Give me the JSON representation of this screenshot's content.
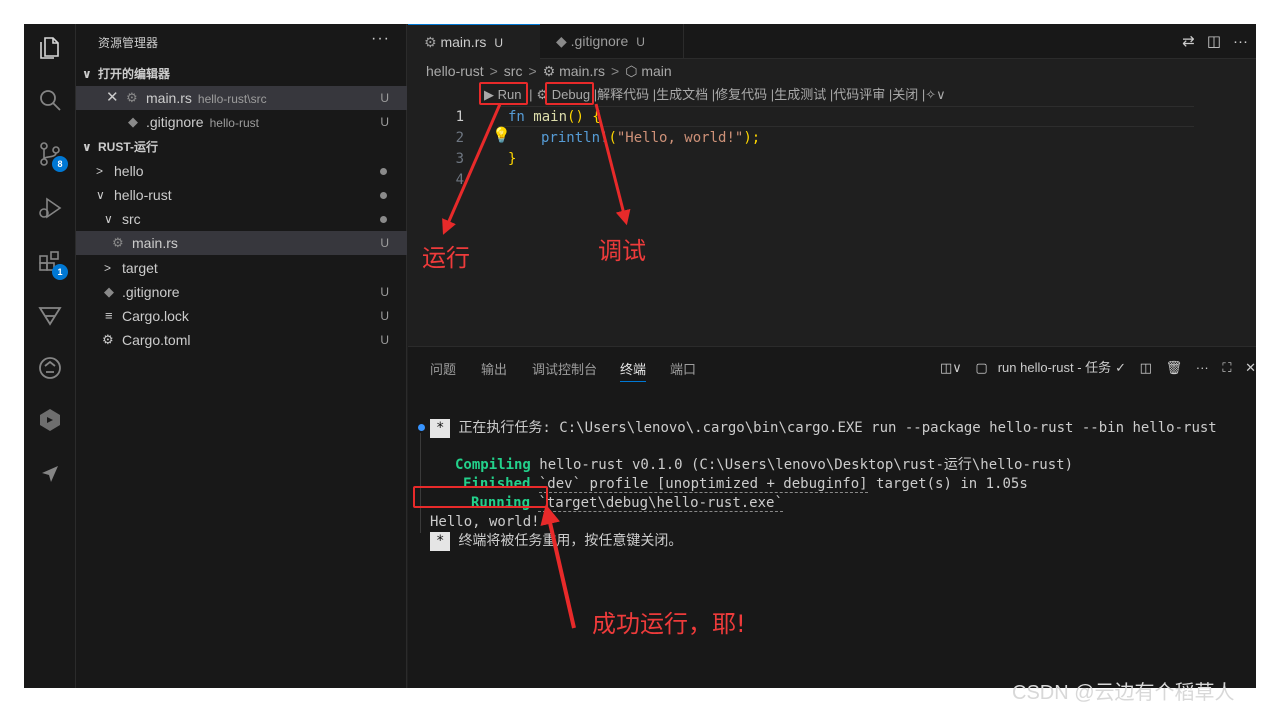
{
  "explorer": {
    "title": "资源管理器",
    "more": "···",
    "open_editors_header": "打开的编辑器",
    "open_editors": [
      {
        "name": "main.rs",
        "path": "hello-rust\\src",
        "status": "U"
      },
      {
        "name": ".gitignore",
        "path": "hello-rust",
        "status": "U"
      }
    ],
    "workspace_header": "RUST-运行",
    "tree": [
      {
        "name": "hello"
      },
      {
        "name": "hello-rust"
      },
      {
        "name": "src"
      },
      {
        "name": "main.rs",
        "status": "U"
      },
      {
        "name": "target"
      },
      {
        "name": ".gitignore",
        "status": "U"
      },
      {
        "name": "Cargo.lock",
        "status": "U"
      },
      {
        "name": "Cargo.toml",
        "status": "U"
      }
    ]
  },
  "activity_badges": {
    "source_control": "8",
    "extensions": "1"
  },
  "tabs": [
    {
      "label": "main.rs",
      "status": "U"
    },
    {
      "label": ".gitignore",
      "status": "U"
    }
  ],
  "breadcrumb": [
    "hello-rust",
    "src",
    "main.rs",
    "main"
  ],
  "codelens": {
    "run": "▶ Run",
    "debug": "Debug",
    "items": [
      "解释代码",
      "生成文档",
      "修复代码",
      "生成测试",
      "代码评审",
      "关闭"
    ]
  },
  "code": {
    "line_numbers": [
      "1",
      "2",
      "3",
      "4"
    ],
    "line1_kw": "fn",
    "line1_name": "main",
    "line1_rest": "() {",
    "line2_macro": "println!",
    "line2_open": "(",
    "line2_str": "\"Hello, world!\"",
    "line2_close": ");",
    "line3": "}"
  },
  "panel": {
    "tabs": [
      "问题",
      "输出",
      "调试控制台",
      "终端",
      "端口"
    ],
    "active_tab": "终端",
    "task_label": "run hello-rust - 任务"
  },
  "terminal": {
    "star": "*",
    "task_line": "正在执行任务: C:\\Users\\lenovo\\.cargo\\bin\\cargo.EXE run --package hello-rust --bin hello-rust",
    "compiling_label": "Compiling",
    "compiling_text": " hello-rust v0.1.0 (C:\\Users\\lenovo\\Desktop\\rust-运行\\hello-rust)",
    "finished_label": "Finished",
    "finished_ul": "`dev` profile [unoptimized + debuginfo]",
    "finished_text": " target(s) in 1.05s",
    "running_label": "Running",
    "running_ul": "`target\\debug\\hello-rust.exe`",
    "output": "Hello, world!",
    "reuse_line": "终端将被任务重用，按任意键关闭。"
  },
  "annotations": {
    "run": "运行",
    "debug": "调试",
    "success": "成功运行，耶!",
    "color": "#e82a2a"
  },
  "watermark": "CSDN @云边有个稻草人"
}
